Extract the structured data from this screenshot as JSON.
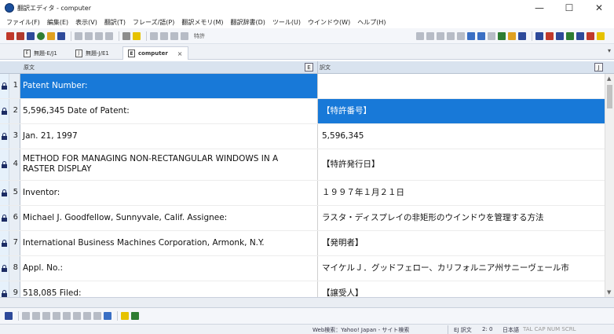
{
  "window": {
    "title": "翻訳エディタ - computer",
    "minimize": "—",
    "maximize": "☐",
    "close": "✕"
  },
  "menu": {
    "items": [
      "ファイル(F)",
      "編集(E)",
      "表示(V)",
      "翻訳(T)",
      "フレーズ/語(P)",
      "翻訳メモリ(M)",
      "翻訳辞書(D)",
      "ツール(U)",
      "ウインドウ(W)",
      "ヘルプ(H)"
    ]
  },
  "toolbar": {
    "field_label": "特許"
  },
  "tabs": [
    {
      "label": "無題-E/J1",
      "icon_letter": "E"
    },
    {
      "label": "無題-J/E1",
      "icon_letter": "J"
    },
    {
      "label": "computer",
      "icon_letter": "E",
      "close": "×"
    }
  ],
  "grid": {
    "source_header": "原文",
    "target_header": "訳文",
    "source_btn": "E",
    "target_btn": "J"
  },
  "rows": [
    {
      "num": "1",
      "source": "Patent Number:",
      "source_lines": [
        "Patent Number:"
      ],
      "target_lines": [
        ""
      ],
      "source_selected": true,
      "target_selected": false
    },
    {
      "num": "2",
      "source_lines": [
        "5,596,345 Date of Patent:"
      ],
      "target_lines": [
        "【特許番号】"
      ],
      "source_selected": false,
      "target_selected": true
    },
    {
      "num": "3",
      "source_lines": [
        "Jan. 21, 1997"
      ],
      "target_lines": [
        "5,596,345"
      ],
      "source_selected": false,
      "target_selected": false
    },
    {
      "num": "4",
      "source_lines": [
        "METHOD FOR MANAGING NON-RECTANGULAR WINDOWS IN A",
        "RASTER DISPLAY"
      ],
      "target_lines": [
        "【特許発行日】"
      ],
      "source_selected": false,
      "target_selected": false
    },
    {
      "num": "5",
      "source_lines": [
        "Inventor:"
      ],
      "target_lines": [
        "１９９７年１月２１日"
      ],
      "source_selected": false,
      "target_selected": false
    },
    {
      "num": "6",
      "source_lines": [
        "Michael J. Goodfellow, Sunnyvale, Calif. Assignee:"
      ],
      "target_lines": [
        "ラスタ・ディスプレイの非矩形のウインドウを管理する方法"
      ],
      "source_selected": false,
      "target_selected": false
    },
    {
      "num": "7",
      "source_lines": [
        "International Business Machines Corporation, Armonk, N.Y."
      ],
      "target_lines": [
        "【発明者】"
      ],
      "source_selected": false,
      "target_selected": false
    },
    {
      "num": "8",
      "source_lines": [
        "Appl. No.:"
      ],
      "target_lines": [
        "マイケルＪ．グッドフェロー、カリフォルニア州サニーヴェール市"
      ],
      "source_selected": false,
      "target_selected": false
    },
    {
      "num": "9",
      "source_lines": [
        "518,085 Filed:"
      ],
      "target_lines": [
        "【譲受人】"
      ],
      "source_selected": false,
      "target_selected": false
    }
  ],
  "status": {
    "search": "Web検索：Yahoo! Japan - サイト検索",
    "mode": "EJ 訳文",
    "page": "2: 0",
    "lang": "日本語",
    "indicators": "TAL CAP NUM SCRL"
  },
  "colors": {
    "selection": "#1879d8",
    "header_bg": "#d9e3ef",
    "lock": "#1c2c64"
  }
}
